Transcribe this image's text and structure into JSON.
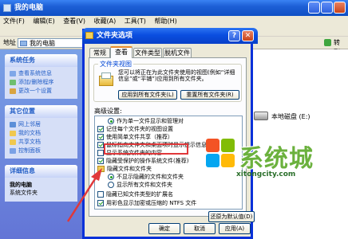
{
  "bg_window": {
    "title": "我的电脑",
    "menu": [
      "文件(F)",
      "编辑(E)",
      "查看(V)",
      "收藏(A)",
      "工具(T)",
      "帮助(H)"
    ],
    "address_label": "地址",
    "address_value": "我的电脑",
    "go_label": "转到"
  },
  "sidebar": {
    "system_tasks": {
      "title": "系统任务",
      "items": [
        "查看系统信息",
        "添加/删除程序",
        "更改一个设置"
      ]
    },
    "other_places": {
      "title": "其它位置",
      "items": [
        "网上邻居",
        "我的文档",
        "共享文档",
        "控制面板"
      ]
    },
    "details": {
      "title": "详细信息",
      "name": "我的电脑",
      "desc": "系统文件夹"
    }
  },
  "drive": {
    "label": "本地磁盘 (E:)"
  },
  "dialog": {
    "title": "文件夹选项",
    "help_glyph": "?",
    "close_glyph": "✕",
    "tabs": [
      "常规",
      "查看",
      "文件类型",
      "脱机文件"
    ],
    "active_tab": "查看",
    "folder_views": {
      "title": "文件夹视图",
      "description": "您可以将正在为此文件夹使用的视图(例如“详细信息”或“平铺”)应用到所有文件夹。",
      "apply_all_label": "应用到所有文件夹(L)",
      "reset_all_label": "重置所有文件夹(R)"
    },
    "advanced_label": "高级设置:",
    "settings": [
      "作为单一文件显示和管理对",
      "记住每个文件夹的视图设置",
      "使用简单文件共享（推荐）",
      "鼠标指向文件夹和桌面项时显示提示信息",
      "显示系统文件夹的内容",
      "隐藏受保护的操作系统文件(推荐)",
      "隐藏文件和文件夹",
      "不显示隐藏的文件和文件夹",
      "显示所有文件和文件夹",
      "隐藏已知文件类型的扩展名",
      "用彩色显示加密或压缩的 NTFS 文件"
    ],
    "restore_label": "还原为默认值(D)",
    "ok_label": "确定",
    "cancel_label": "取消",
    "apply_label": "应用(A)"
  },
  "watermark": {
    "text": "系统城",
    "url": "xitongcity.com"
  },
  "colors": {
    "xp_blue": "#0a4ee0",
    "highlight_red": "#e0383a",
    "watermark_green": "#6bb13d"
  }
}
